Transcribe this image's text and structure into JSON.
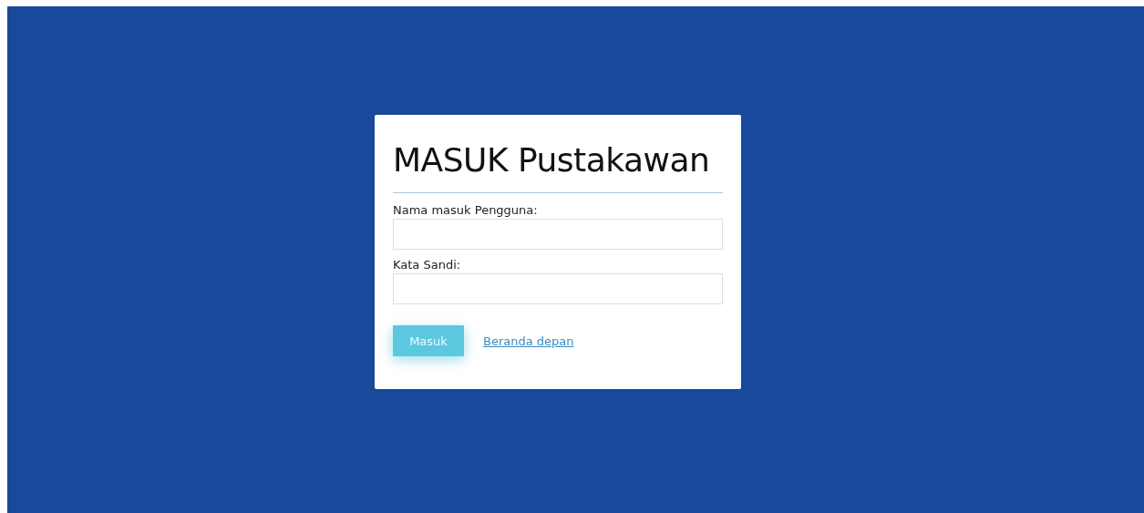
{
  "title": "MASUK Pustakawan",
  "fields": [
    {
      "label": "Nama masuk Pengguna:"
    },
    {
      "label": "Kata Sandi:"
    }
  ],
  "submit": "Masuk",
  "link": "Beranda depan"
}
